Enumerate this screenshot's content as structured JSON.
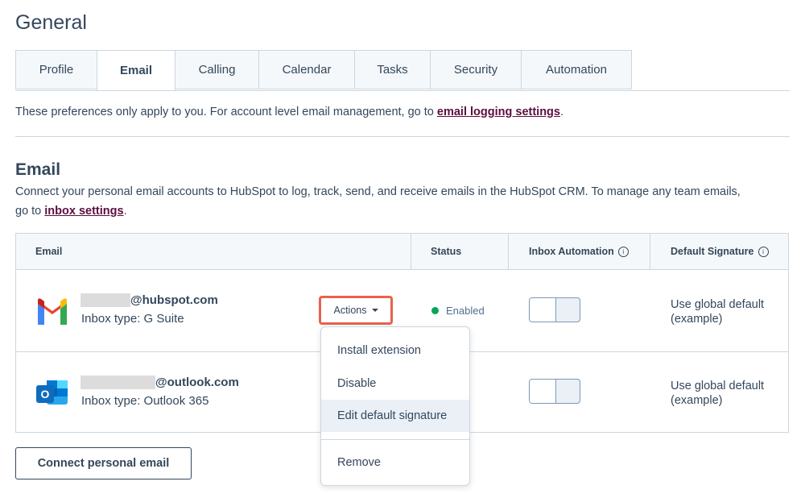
{
  "page_title": "General",
  "tabs": [
    {
      "label": "Profile",
      "active": false
    },
    {
      "label": "Email",
      "active": true
    },
    {
      "label": "Calling",
      "active": false
    },
    {
      "label": "Calendar",
      "active": false
    },
    {
      "label": "Tasks",
      "active": false
    },
    {
      "label": "Security",
      "active": false
    },
    {
      "label": "Automation",
      "active": false
    }
  ],
  "preferences_note": {
    "text": "These preferences only apply to you. For account level email management, go to ",
    "link": "email logging settings",
    "suffix": "."
  },
  "email_section": {
    "title": "Email",
    "description": "Connect your personal email accounts to HubSpot to log, track, send, and receive emails in the HubSpot CRM. To manage any team emails, go to ",
    "link": "inbox settings",
    "suffix": "."
  },
  "table": {
    "headers": {
      "email": "Email",
      "status": "Status",
      "inbox_automation": "Inbox Automation",
      "default_signature": "Default Signature"
    },
    "rows": [
      {
        "icon": "gmail-icon",
        "address": "@hubspot.com",
        "inbox_type": "Inbox type: G Suite",
        "status": "Enabled",
        "automation_on": false,
        "signature": "Use global default (example)"
      },
      {
        "icon": "outlook-icon",
        "address": "@outlook.com",
        "inbox_type": "Inbox type: Outlook 365",
        "status_visible": "led",
        "automation_on": false,
        "signature": "Use global default (example)"
      }
    ]
  },
  "actions_button": {
    "label": "Actions"
  },
  "actions_menu": {
    "items": [
      "Install extension",
      "Disable",
      "Edit default signature",
      "Remove"
    ],
    "highlighted": "Edit default signature"
  },
  "connect_button": {
    "label": "Connect personal email"
  },
  "colors": {
    "text": "#33475b",
    "link": "#5b0e3e",
    "border": "#cbd6e2",
    "header_bg": "#f5f8fa",
    "status_green": "#00a65a",
    "highlight_border": "#e8624c",
    "menu_highlight": "#eaf0f6"
  }
}
